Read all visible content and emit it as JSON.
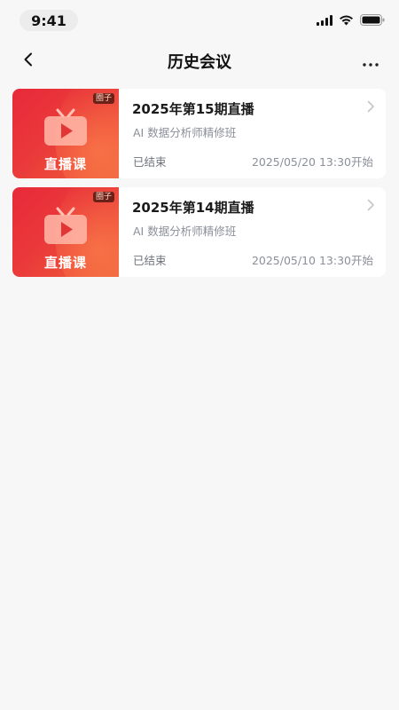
{
  "status_bar": {
    "time": "9:41",
    "icons": [
      "signal-icon",
      "wifi-icon",
      "battery-icon"
    ]
  },
  "nav": {
    "title": "历史会议",
    "back_icon": "chevron-left-icon",
    "more_icon": "more-horizontal-icon"
  },
  "colors": {
    "background": "#f7f7f7",
    "card": "#ffffff",
    "thumb_red": "#e8293a",
    "thumb_orange": "#f0603a",
    "text_primary": "#1b1b1b",
    "text_secondary": "#8a8f99"
  },
  "meetings": [
    {
      "thumb_badge": "圈子",
      "thumb_label": "直播课",
      "title": "2025年第15期直播",
      "course": "AI 数据分析师精修班",
      "status": "已结束",
      "start_time": "2025/05/20 13:30开始"
    },
    {
      "thumb_badge": "圈子",
      "thumb_label": "直播课",
      "title": "2025年第14期直播",
      "course": "AI 数据分析师精修班",
      "status": "已结束",
      "start_time": "2025/05/10 13:30开始"
    }
  ]
}
